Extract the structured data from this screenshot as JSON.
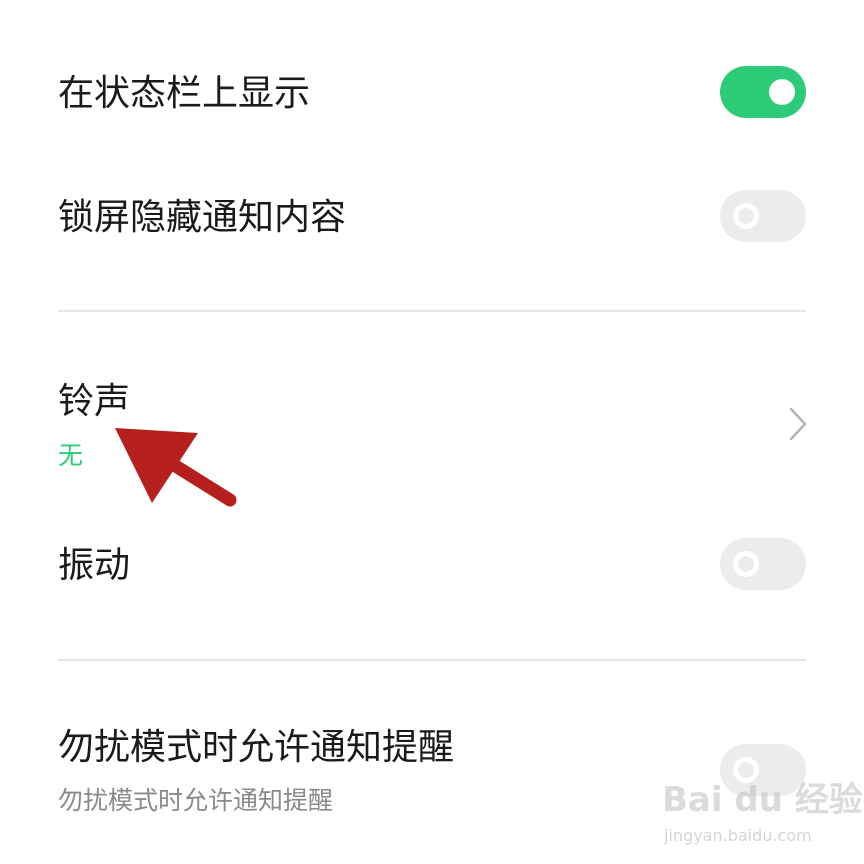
{
  "settings": {
    "show_in_status_bar": {
      "label": "在状态栏上显示",
      "enabled": true
    },
    "hide_on_lock_screen": {
      "label": "锁屏隐藏通知内容",
      "enabled": false
    },
    "ringtone": {
      "label": "铃声",
      "value": "无"
    },
    "vibration": {
      "label": "振动",
      "enabled": false
    },
    "dnd_allow": {
      "label": "勿扰模式时允许通知提醒",
      "description": "勿扰模式时允许通知提醒",
      "enabled": false
    }
  },
  "watermark": {
    "logo": "Bai du 经验",
    "url": "jingyan.baidu.com"
  },
  "colors": {
    "accent": "#2ccb77",
    "toggle_off": "#ececec",
    "text": "#1a1a1a",
    "secondary_text": "#8a8a8a",
    "annotation_arrow": "#b5201c"
  },
  "icons": {
    "ringtone_chevron": "chevron-right-icon",
    "annotation": "red-arrow-icon"
  }
}
